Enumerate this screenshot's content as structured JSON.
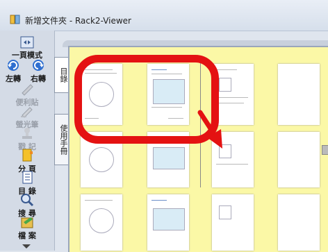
{
  "window": {
    "title": "新增文件夾 - Rack2-Viewer"
  },
  "toolbar": {
    "single_page": "一頁模式",
    "rotate_left": "左轉",
    "rotate_right": "右轉",
    "sticky_note": "便利貼",
    "highlighter": "螢光筆",
    "record": "戳 記",
    "section": "分 頁",
    "toc": "目 錄",
    "search": "搜 尋",
    "file": "檔 案"
  },
  "tabs": {
    "toc": "目錄",
    "manual": "使用手冊"
  },
  "colors": {
    "highlight": "#e41212",
    "viewer_bg": "#fbf8a6"
  }
}
